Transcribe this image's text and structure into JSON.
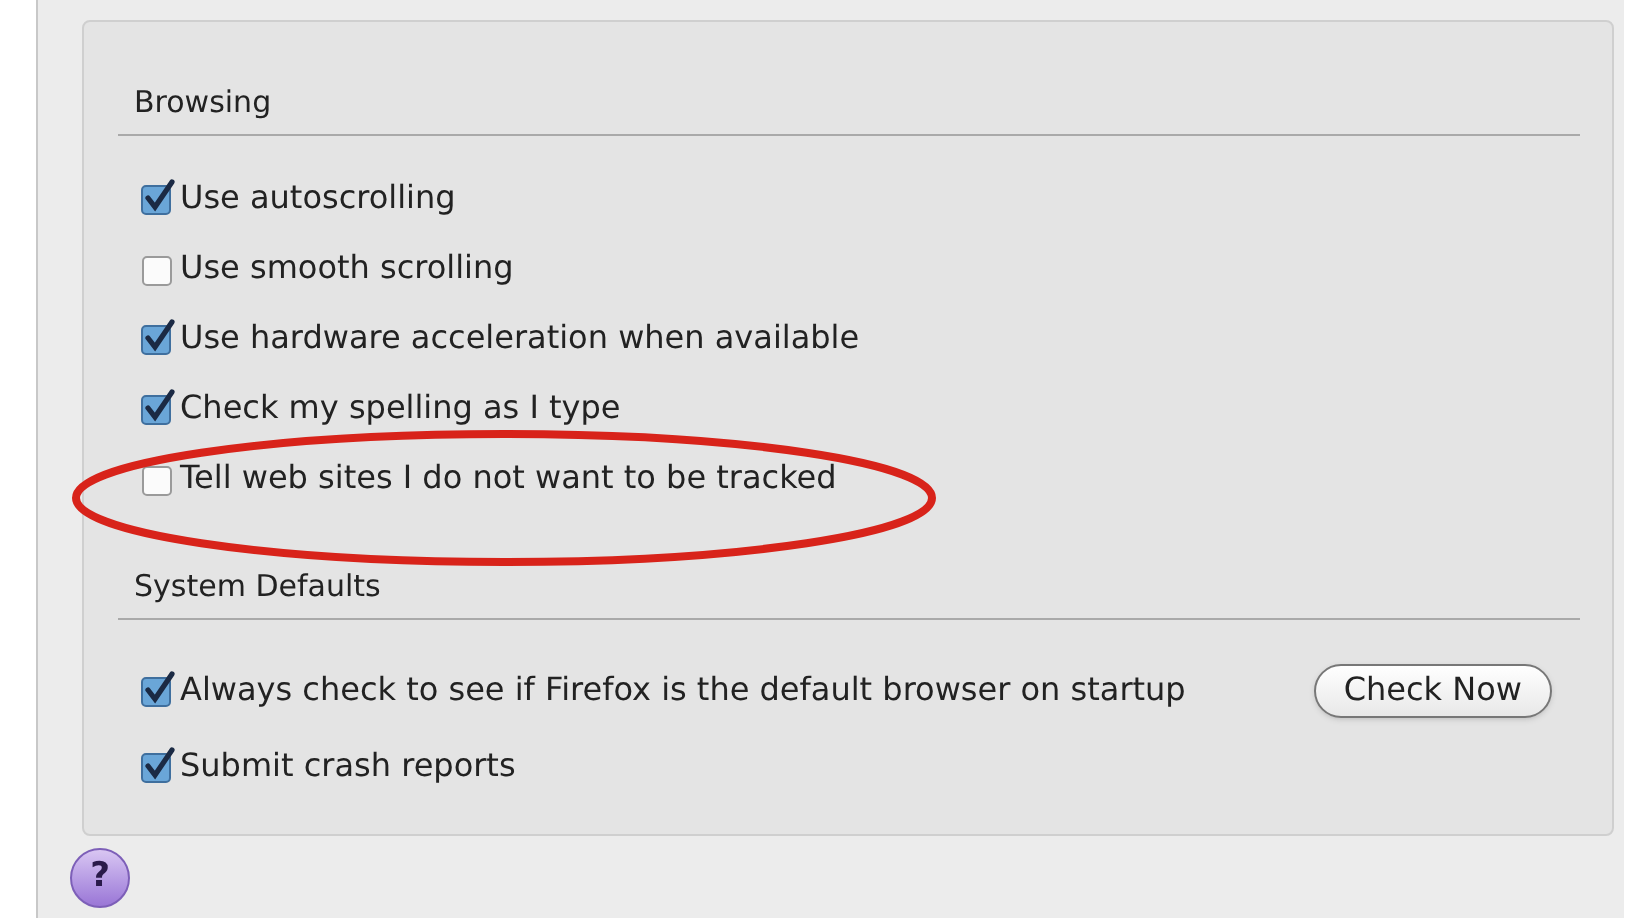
{
  "sections": [
    {
      "title": "Browsing",
      "options": [
        {
          "label": "Use autoscrolling",
          "checked": true
        },
        {
          "label": "Use smooth scrolling",
          "checked": false
        },
        {
          "label": "Use hardware acceleration when available",
          "checked": true
        },
        {
          "label": "Check my spelling as I type",
          "checked": true
        },
        {
          "label": "Tell web sites I do not want to be tracked",
          "checked": false
        }
      ]
    },
    {
      "title": "System Defaults",
      "options": [
        {
          "label": "Always check to see if Firefox is the default browser on startup",
          "checked": true,
          "button": "Check Now"
        },
        {
          "label": "Submit crash reports",
          "checked": true
        }
      ]
    }
  ],
  "help_button": "?",
  "annotation": {
    "kind": "ellipse"
  }
}
